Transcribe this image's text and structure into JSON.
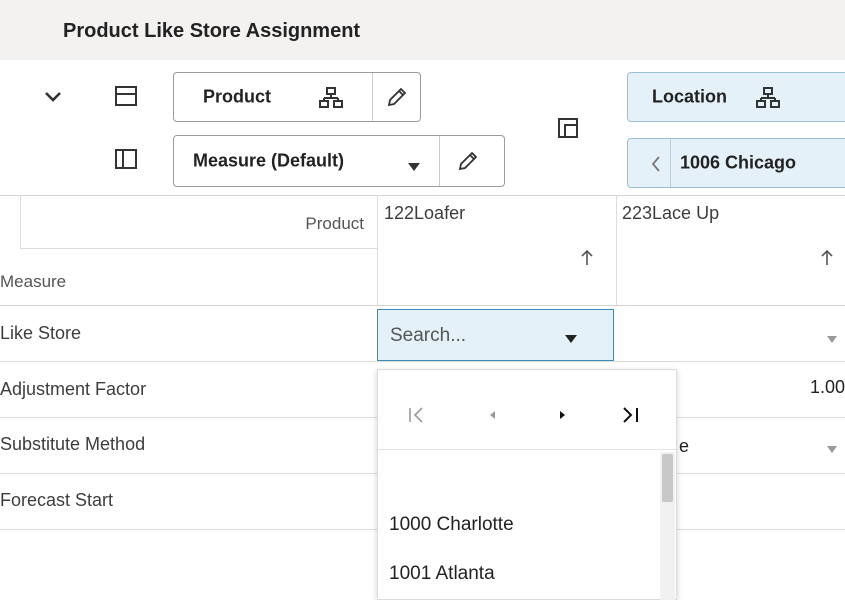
{
  "title": "Product Like Store Assignment",
  "toolbar": {
    "product_tile": "Product",
    "measure_tile": "Measure (Default)",
    "location_tile": "Location",
    "location_value": "1006 Chicago"
  },
  "grid": {
    "product_axis_label": "Product",
    "measure_axis_label": "Measure",
    "columns": [
      "122Loafer",
      "223Lace Up"
    ],
    "rows": [
      "Like Store",
      "Adjustment Factor",
      "Substitute Method",
      "Forecast Start"
    ],
    "adjustment_factor_col2": "1.00",
    "substitute_method_col2_partial": "e"
  },
  "search": {
    "placeholder": "Search..."
  },
  "dropdown": {
    "options": [
      "1000 Charlotte",
      "1001 Atlanta"
    ]
  },
  "colors": {
    "accent": "#3a8bb5",
    "accent_bg": "#e5f1f8",
    "header_bg": "#f3f2f1"
  },
  "icons": {
    "collapse": "chevron-down-icon",
    "layout_rows": "layout-rows-icon",
    "layout_cols": "layout-columns-icon",
    "hierarchy": "hierarchy-icon",
    "edit": "pencil-icon",
    "pivot": "pivot-icon",
    "sort": "sort-up-icon"
  }
}
